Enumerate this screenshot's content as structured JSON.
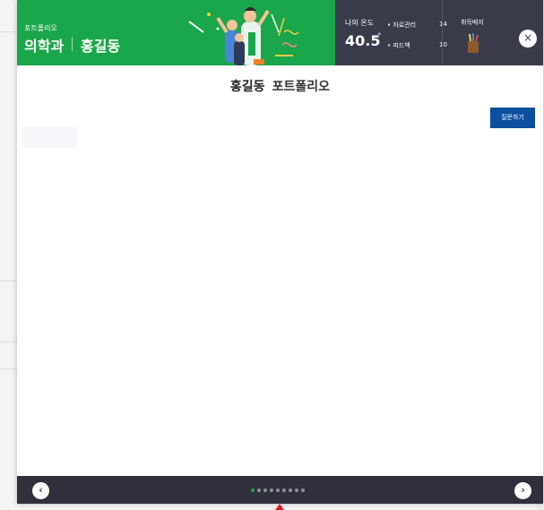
{
  "header": {
    "portfolio_label": "포트폴리오",
    "department": "의학과",
    "student_name": "홍길동",
    "temperature": {
      "label": "나의 온도",
      "value": "40.5",
      "unit": "°"
    },
    "stats": [
      {
        "label": "• 자료관리",
        "value": "14"
      },
      {
        "label": "• 피드백",
        "value": "10"
      }
    ],
    "badge": {
      "label": "취득배지",
      "icon": "pencil-holder-icon"
    },
    "colors": {
      "green": "#1aa64a",
      "dark": "#3a3b4a"
    }
  },
  "main": {
    "title_name": "홍길동",
    "title_suffix": "포트폴리오",
    "ask_button": "질문하기"
  },
  "pagination": {
    "total_pages": 9,
    "active_page": 1,
    "active_color": "#1aa64a",
    "prev_icon": "chevron-left-icon",
    "next_icon": "chevron-right-icon"
  }
}
